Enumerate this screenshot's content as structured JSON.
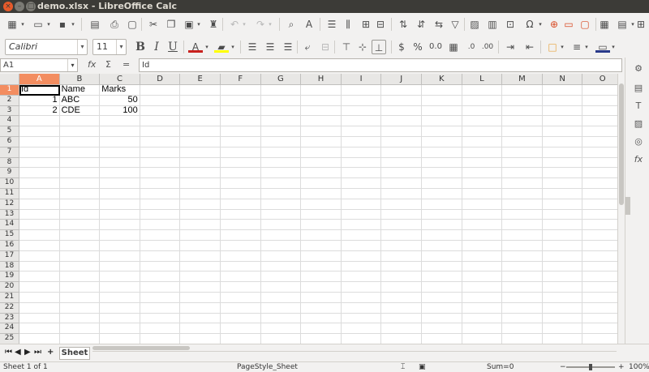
{
  "window": {
    "title": "demo.xlsx - LibreOffice Calc"
  },
  "toolbar": {
    "font_name": "Calibri",
    "font_size": "11",
    "bold_label": "B",
    "italic_label": "I",
    "underline_label": "U"
  },
  "formula_bar": {
    "name_box": "A1",
    "function_wizard_label": "fx",
    "sum_label": "Σ",
    "equals_label": "=",
    "content": "Id"
  },
  "columns": [
    "A",
    "B",
    "C",
    "D",
    "E",
    "F",
    "G",
    "H",
    "I",
    "J",
    "K",
    "L",
    "M",
    "N",
    "O"
  ],
  "rows": [
    "1",
    "2",
    "3",
    "4",
    "5",
    "6",
    "7",
    "8",
    "9",
    "10",
    "11",
    "12",
    "13",
    "14",
    "15",
    "16",
    "17",
    "18",
    "19",
    "20",
    "21",
    "22",
    "23",
    "24",
    "25"
  ],
  "cells": {
    "A1": "Id",
    "B1": "Name",
    "C1": "Marks",
    "A2": "1",
    "B2": "ABC",
    "C2": "50",
    "A3": "2",
    "B3": "CDE",
    "C3": "100"
  },
  "sheet_tabs": [
    "Sheet"
  ],
  "status": {
    "sheet_position": "Sheet 1 of 1",
    "page_style": "PageStyle_Sheet",
    "sum": "Sum=0",
    "zoom": "100%"
  },
  "colors": {
    "selection_header": "#f38d60",
    "titlebar": "#3c3b37",
    "close_button": "#e75a2a"
  }
}
